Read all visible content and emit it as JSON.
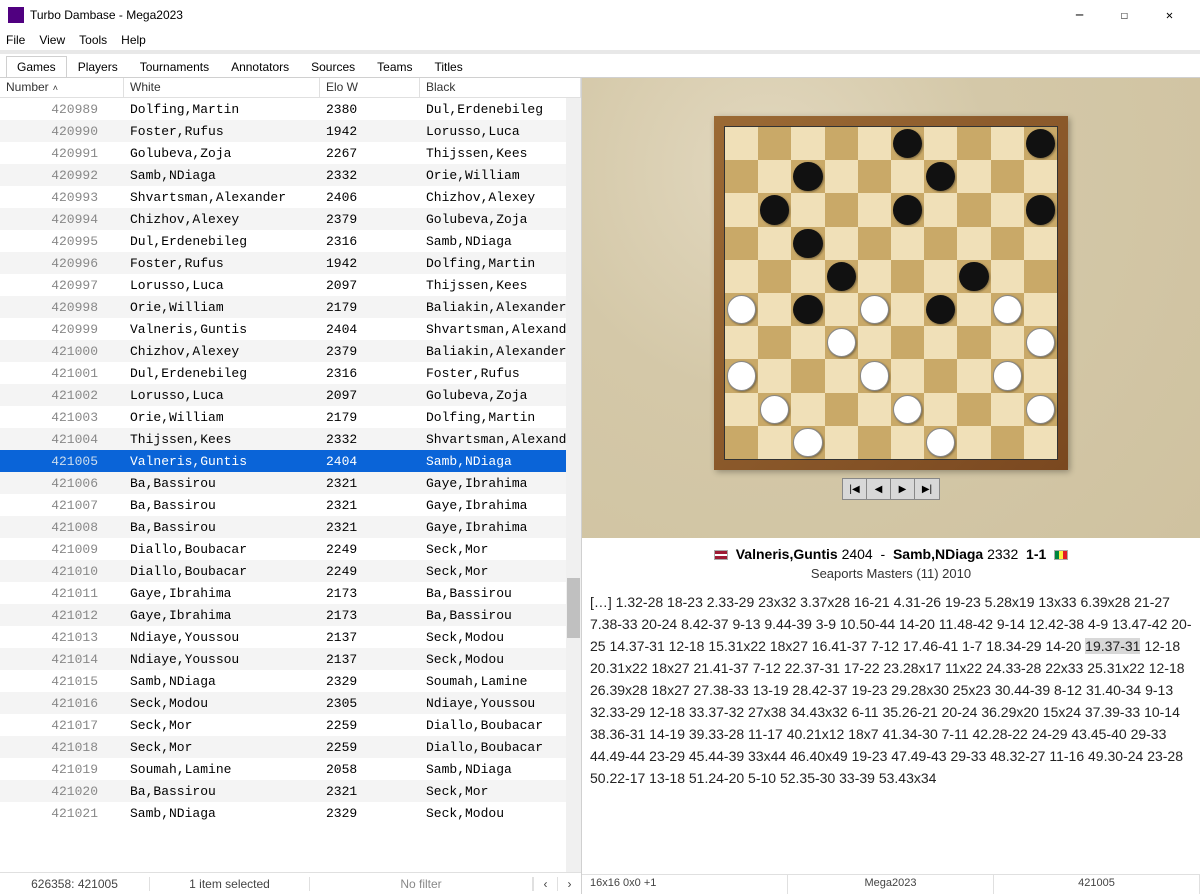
{
  "window": {
    "title": "Turbo Dambase - Mega2023"
  },
  "menu": [
    "File",
    "View",
    "Tools",
    "Help"
  ],
  "tabs": [
    "Games",
    "Players",
    "Tournaments",
    "Annotators",
    "Sources",
    "Teams",
    "Titles"
  ],
  "active_tab": 0,
  "columns": {
    "number": "Number",
    "white": "White",
    "elo": "Elo W",
    "black": "Black"
  },
  "selected_number": "421005",
  "rows": [
    {
      "n": "420989",
      "w": "Dolfing,Martin",
      "e": "2380",
      "b": "Dul,Erdenebileg"
    },
    {
      "n": "420990",
      "w": "Foster,Rufus",
      "e": "1942",
      "b": "Lorusso,Luca"
    },
    {
      "n": "420991",
      "w": "Golubeva,Zoja",
      "e": "2267",
      "b": "Thijssen,Kees"
    },
    {
      "n": "420992",
      "w": "Samb,NDiaga",
      "e": "2332",
      "b": "Orie,William"
    },
    {
      "n": "420993",
      "w": "Shvartsman,Alexander",
      "e": "2406",
      "b": "Chizhov,Alexey"
    },
    {
      "n": "420994",
      "w": "Chizhov,Alexey",
      "e": "2379",
      "b": "Golubeva,Zoja"
    },
    {
      "n": "420995",
      "w": "Dul,Erdenebileg",
      "e": "2316",
      "b": "Samb,NDiaga"
    },
    {
      "n": "420996",
      "w": "Foster,Rufus",
      "e": "1942",
      "b": "Dolfing,Martin"
    },
    {
      "n": "420997",
      "w": "Lorusso,Luca",
      "e": "2097",
      "b": "Thijssen,Kees"
    },
    {
      "n": "420998",
      "w": "Orie,William",
      "e": "2179",
      "b": "Baliakin,Alexander"
    },
    {
      "n": "420999",
      "w": "Valneris,Guntis",
      "e": "2404",
      "b": "Shvartsman,Alexander"
    },
    {
      "n": "421000",
      "w": "Chizhov,Alexey",
      "e": "2379",
      "b": "Baliakin,Alexander"
    },
    {
      "n": "421001",
      "w": "Dul,Erdenebileg",
      "e": "2316",
      "b": "Foster,Rufus"
    },
    {
      "n": "421002",
      "w": "Lorusso,Luca",
      "e": "2097",
      "b": "Golubeva,Zoja"
    },
    {
      "n": "421003",
      "w": "Orie,William",
      "e": "2179",
      "b": "Dolfing,Martin"
    },
    {
      "n": "421004",
      "w": "Thijssen,Kees",
      "e": "2332",
      "b": "Shvartsman,Alexander"
    },
    {
      "n": "421005",
      "w": "Valneris,Guntis",
      "e": "2404",
      "b": "Samb,NDiaga"
    },
    {
      "n": "421006",
      "w": "Ba,Bassirou",
      "e": "2321",
      "b": "Gaye,Ibrahima"
    },
    {
      "n": "421007",
      "w": "Ba,Bassirou",
      "e": "2321",
      "b": "Gaye,Ibrahima"
    },
    {
      "n": "421008",
      "w": "Ba,Bassirou",
      "e": "2321",
      "b": "Gaye,Ibrahima"
    },
    {
      "n": "421009",
      "w": "Diallo,Boubacar",
      "e": "2249",
      "b": "Seck,Mor"
    },
    {
      "n": "421010",
      "w": "Diallo,Boubacar",
      "e": "2249",
      "b": "Seck,Mor"
    },
    {
      "n": "421011",
      "w": "Gaye,Ibrahima",
      "e": "2173",
      "b": "Ba,Bassirou"
    },
    {
      "n": "421012",
      "w": "Gaye,Ibrahima",
      "e": "2173",
      "b": "Ba,Bassirou"
    },
    {
      "n": "421013",
      "w": "Ndiaye,Youssou",
      "e": "2137",
      "b": "Seck,Modou"
    },
    {
      "n": "421014",
      "w": "Ndiaye,Youssou",
      "e": "2137",
      "b": "Seck,Modou"
    },
    {
      "n": "421015",
      "w": "Samb,NDiaga",
      "e": "2329",
      "b": "Soumah,Lamine"
    },
    {
      "n": "421016",
      "w": "Seck,Modou",
      "e": "2305",
      "b": "Ndiaye,Youssou"
    },
    {
      "n": "421017",
      "w": "Seck,Mor",
      "e": "2259",
      "b": "Diallo,Boubacar"
    },
    {
      "n": "421018",
      "w": "Seck,Mor",
      "e": "2259",
      "b": "Diallo,Boubacar"
    },
    {
      "n": "421019",
      "w": "Soumah,Lamine",
      "e": "2058",
      "b": "Samb,NDiaga"
    },
    {
      "n": "421020",
      "w": "Ba,Bassirou",
      "e": "2321",
      "b": "Seck,Mor"
    },
    {
      "n": "421021",
      "w": "Samb,NDiaga",
      "e": "2329",
      "b": "Seck,Modou"
    }
  ],
  "status": {
    "left": "626358: 421005",
    "center": "1 item selected",
    "filter": "No filter"
  },
  "game": {
    "white": "Valneris,Guntis",
    "white_elo": "2404",
    "black": "Samb,NDiaga",
    "black_elo": "2332",
    "result": "1-1",
    "event": "Seaports Masters (11) 2010",
    "highlight_move": "19.37-31",
    "notation": "[…]  1.32-28  18-23  2.33-29  23x32  3.37x28  16-21  4.31-26  19-23  5.28x19  13x33  6.39x28  21-27  7.38-33  20-24  8.42-37  9-13  9.44-39  3-9  10.50-44  14-20  11.48-42  9-14  12.42-38  4-9  13.47-42  20-25  14.37-31  12-18  15.31x22  18x27  16.41-37  7-12  17.46-41  1-7  18.34-29  14-20  19.37-31  12-18  20.31x22  18x27  21.41-37  7-12  22.37-31  17-22  23.28x17  11x22  24.33-28  22x33  25.31x22  12-18  26.39x28  18x27  27.38-33  13-19  28.42-37  19-23  29.28x30  25x23  30.44-39  8-12  31.40-34  9-13  32.33-29  12-18  33.37-32  27x38  34.43x32  6-11  35.26-21  20-24  36.29x20  15x24  37.39-33  10-14  38.36-31  14-19  39.33-28  11-17  40.21x12  18x7  41.34-30  7-11  42.28-22  24-29  43.45-40  29-33  44.49-44  23-29  45.44-39  33x44  46.40x49  19-23  47.49-43  29-33  48.32-27  11-16  49.30-24  23-28  50.22-17  13-18  51.24-20  5-10  52.35-30  33-39  53.43x34"
  },
  "bottom": {
    "coord": "16x16 0x0 +1",
    "db": "Mega2023",
    "id": "421005"
  },
  "board": {
    "black": [
      3,
      5,
      7,
      9,
      11,
      13,
      15,
      17,
      22,
      24,
      27,
      29
    ],
    "white": [
      26,
      28,
      30,
      32,
      35,
      36,
      38,
      40,
      41,
      43,
      45,
      47,
      49
    ]
  }
}
